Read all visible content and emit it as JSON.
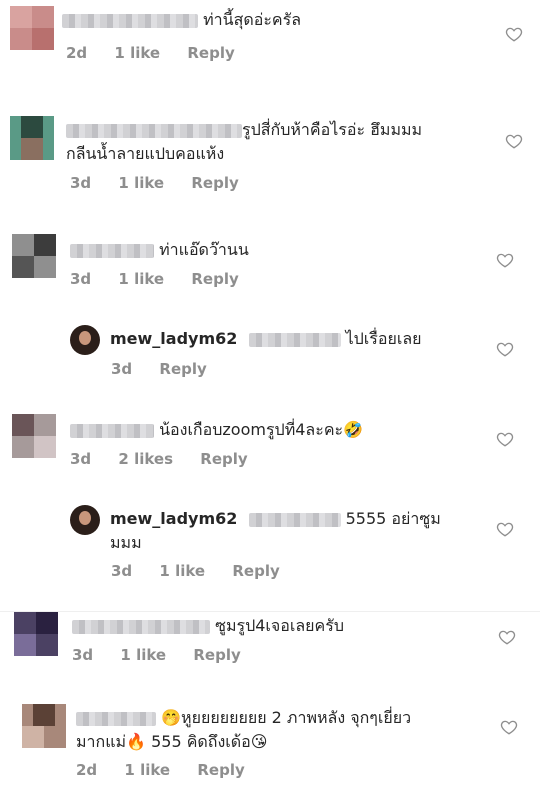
{
  "comments": [
    {
      "text": "ท่านี้สุดอ่ะครัล",
      "time": "2d",
      "likes": "1 like",
      "reply": "Reply"
    },
    {
      "text_line1": "รูปสี่กับห้าคือไรอ่ะ ฮึมมมม",
      "text_line2": "กลีนน้ำลายแปบคอแห้ง",
      "time": "3d",
      "likes": "1 like",
      "reply": "Reply"
    },
    {
      "text": "ท่าแอ๊ดว๊านน",
      "time": "3d",
      "likes": "1 like",
      "reply": "Reply"
    },
    {
      "handle": "mew_ladym62",
      "text": "ไปเรื่อยเลย",
      "time": "3d",
      "reply": "Reply"
    },
    {
      "text": "น้องเกือบzoomรูปที่4ละคะ🤣",
      "time": "3d",
      "likes": "2 likes",
      "reply": "Reply"
    },
    {
      "handle": "mew_ladym62",
      "text_line1": "5555 อย่าซูม",
      "text_line2": "มมม",
      "time": "3d",
      "likes": "1 like",
      "reply": "Reply"
    },
    {
      "text": "ซูมรูป4เจอเลยครับ",
      "time": "3d",
      "likes": "1 like",
      "reply": "Reply"
    },
    {
      "text_line1": "🤭หูยยยยยยยย 2 ภาพหลัง จุกๆเยี่ยว",
      "text_line2": "มากแม่🔥 555 คิดถึงเด้อ😘",
      "time": "2d",
      "likes": "1 like",
      "reply": "Reply"
    }
  ]
}
